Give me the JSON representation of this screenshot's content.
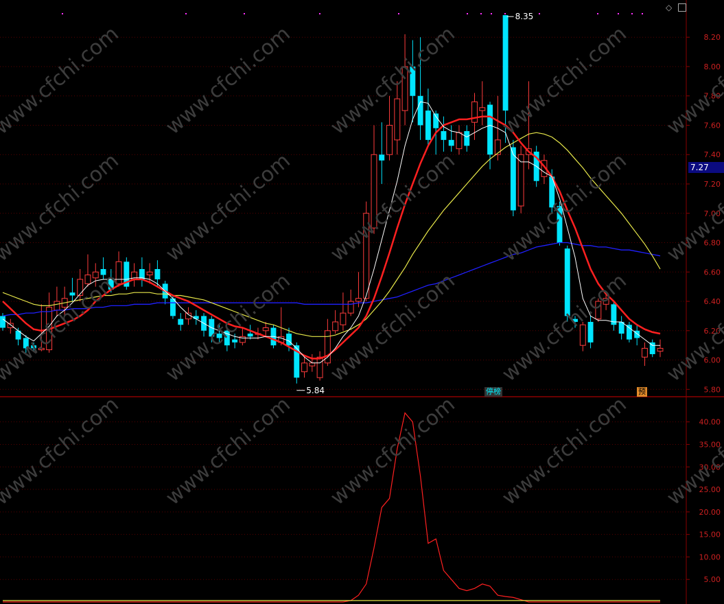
{
  "chart_data": [
    {
      "type": "candlestick",
      "title": "",
      "y_ticks": [
        "8.20",
        "8.00",
        "7.80",
        "7.60",
        "7.40",
        "7.20",
        "7.00",
        "6.80",
        "6.60",
        "6.40",
        "6.20",
        "6.00",
        "5.80"
      ],
      "ylim": [
        5.75,
        8.36
      ],
      "current_price_label": "7.27",
      "high_annotation": "8.35",
      "low_annotation": "5.84",
      "event_badges": [
        "停榜",
        "预"
      ],
      "colors": {
        "up": "#ff3c3c",
        "down": "#00e5ff",
        "ma_white": "#ffffff",
        "ma_red": "#ff2020",
        "ma_yellow": "#e8e84a",
        "ma_blue": "#2020ff",
        "grid": "#5a0000"
      },
      "candles": [
        [
          6.3,
          6.22,
          6.32,
          6.2
        ],
        [
          6.22,
          6.25,
          6.28,
          6.18
        ],
        [
          6.2,
          6.14,
          6.22,
          6.1
        ],
        [
          6.15,
          6.08,
          6.17,
          6.05
        ],
        [
          6.1,
          6.08,
          6.12,
          6.06
        ],
        [
          6.07,
          6.08,
          6.38,
          6.06
        ],
        [
          6.07,
          6.36,
          6.46,
          6.05
        ],
        [
          6.34,
          6.4,
          6.5,
          6.3
        ],
        [
          6.36,
          6.42,
          6.5,
          6.3
        ],
        [
          6.46,
          6.44,
          6.56,
          6.4
        ],
        [
          6.44,
          6.55,
          6.62,
          6.4
        ],
        [
          6.52,
          6.58,
          6.72,
          6.5
        ],
        [
          6.56,
          6.6,
          6.66,
          6.5
        ],
        [
          6.62,
          6.58,
          6.7,
          6.55
        ],
        [
          6.56,
          6.48,
          6.62,
          6.46
        ],
        [
          6.52,
          6.67,
          6.74,
          6.5
        ],
        [
          6.67,
          6.5,
          6.7,
          6.48
        ],
        [
          6.55,
          6.6,
          6.66,
          6.5
        ],
        [
          6.62,
          6.55,
          6.7,
          6.5
        ],
        [
          6.58,
          6.6,
          6.66,
          6.52
        ],
        [
          6.62,
          6.55,
          6.68,
          6.5
        ],
        [
          6.52,
          6.42,
          6.54,
          6.38
        ],
        [
          6.42,
          6.3,
          6.44,
          6.28
        ],
        [
          6.28,
          6.24,
          6.32,
          6.2
        ],
        [
          6.28,
          6.32,
          6.36,
          6.24
        ],
        [
          6.3,
          6.28,
          6.34,
          6.24
        ],
        [
          6.3,
          6.2,
          6.32,
          6.16
        ],
        [
          6.28,
          6.16,
          6.3,
          6.12
        ],
        [
          6.18,
          6.15,
          6.24,
          6.12
        ],
        [
          6.2,
          6.1,
          6.22,
          6.06
        ],
        [
          6.14,
          6.12,
          6.18,
          6.08
        ],
        [
          6.12,
          6.16,
          6.22,
          6.1
        ],
        [
          6.18,
          6.16,
          6.24,
          6.14
        ],
        [
          6.18,
          6.18,
          6.22,
          6.14
        ],
        [
          6.2,
          6.22,
          6.26,
          6.16
        ],
        [
          6.22,
          6.1,
          6.24,
          6.08
        ],
        [
          6.12,
          6.16,
          6.36,
          6.1
        ],
        [
          6.18,
          6.1,
          6.22,
          6.06
        ],
        [
          6.1,
          5.88,
          6.12,
          5.84
        ],
        [
          5.92,
          5.98,
          6.02,
          5.88
        ],
        [
          5.96,
          5.98,
          6.04,
          5.92
        ],
        [
          5.88,
          6.02,
          6.06,
          5.86
        ],
        [
          5.98,
          6.2,
          6.28,
          5.96
        ],
        [
          6.2,
          6.26,
          6.34,
          6.18
        ],
        [
          6.24,
          6.32,
          6.46,
          6.2
        ],
        [
          6.32,
          6.4,
          6.48,
          6.3
        ],
        [
          6.4,
          6.42,
          6.6,
          6.36
        ],
        [
          6.42,
          7.0,
          7.08,
          6.4
        ],
        [
          6.9,
          7.4,
          7.6,
          6.86
        ],
        [
          7.4,
          7.36,
          7.62,
          7.2
        ],
        [
          7.4,
          7.6,
          7.8,
          7.36
        ],
        [
          7.5,
          7.78,
          7.9,
          7.4
        ],
        [
          7.7,
          8.0,
          8.22,
          7.6
        ],
        [
          8.0,
          7.8,
          8.18,
          7.62
        ],
        [
          7.8,
          7.6,
          8.2,
          7.5
        ],
        [
          7.7,
          7.5,
          7.85,
          7.46
        ],
        [
          7.68,
          7.58,
          7.7,
          7.4
        ],
        [
          7.56,
          7.5,
          7.66,
          7.42
        ],
        [
          7.5,
          7.46,
          7.6,
          7.42
        ],
        [
          7.44,
          7.55,
          7.6,
          7.4
        ],
        [
          7.56,
          7.46,
          7.6,
          7.42
        ],
        [
          7.62,
          7.76,
          7.82,
          7.5
        ],
        [
          7.7,
          7.72,
          7.9,
          7.6
        ],
        [
          7.74,
          7.4,
          7.76,
          7.3
        ],
        [
          7.4,
          7.5,
          7.8,
          7.36
        ],
        [
          8.35,
          7.7,
          8.35,
          7.48
        ],
        [
          7.45,
          7.02,
          7.5,
          6.98
        ],
        [
          7.05,
          7.4,
          7.46,
          7.0
        ],
        [
          7.4,
          7.44,
          7.9,
          7.3
        ],
        [
          7.42,
          7.22,
          7.46,
          7.18
        ],
        [
          7.25,
          7.36,
          7.4,
          7.2
        ],
        [
          7.25,
          7.04,
          7.3,
          7.0
        ],
        [
          7.05,
          6.8,
          7.08,
          6.78
        ],
        [
          6.76,
          6.3,
          6.78,
          6.26
        ],
        [
          6.28,
          6.26,
          6.3,
          6.22
        ],
        [
          6.1,
          6.24,
          6.26,
          6.06
        ],
        [
          6.26,
          6.12,
          6.3,
          6.08
        ],
        [
          6.28,
          6.4,
          6.42,
          6.26
        ],
        [
          6.38,
          6.42,
          6.46,
          6.34
        ],
        [
          6.38,
          6.24,
          6.4,
          6.2
        ],
        [
          6.26,
          6.18,
          6.3,
          6.14
        ],
        [
          6.24,
          6.14,
          6.26,
          6.12
        ],
        [
          6.2,
          6.15,
          6.24,
          6.1
        ],
        [
          6.02,
          6.08,
          6.12,
          5.96
        ],
        [
          6.12,
          6.04,
          6.14,
          6.02
        ],
        [
          6.06,
          6.08,
          6.14,
          6.02
        ]
      ],
      "ma_white": [
        6.28,
        6.24,
        6.2,
        6.16,
        6.13,
        6.18,
        6.23,
        6.3,
        6.34,
        6.39,
        6.45,
        6.51,
        6.54,
        6.55,
        6.55,
        6.55,
        6.55,
        6.56,
        6.56,
        6.55,
        6.52,
        6.47,
        6.42,
        6.36,
        6.31,
        6.28,
        6.25,
        6.22,
        6.2,
        6.18,
        6.16,
        6.15,
        6.15,
        6.15,
        6.16,
        6.16,
        6.15,
        6.13,
        6.08,
        6.02,
        5.98,
        5.98,
        6.02,
        6.08,
        6.16,
        6.22,
        6.3,
        6.44,
        6.62,
        6.82,
        7.02,
        7.22,
        7.46,
        7.64,
        7.76,
        7.75,
        7.66,
        7.59,
        7.56,
        7.55,
        7.52,
        7.55,
        7.58,
        7.6,
        7.58,
        7.55,
        7.4,
        7.35,
        7.35,
        7.32,
        7.28,
        7.25,
        7.1,
        6.9,
        6.7,
        6.42,
        6.3,
        6.27,
        6.27,
        6.26,
        6.26,
        6.22,
        6.18,
        6.14,
        6.1,
        6.1
      ],
      "ma_red": [
        6.4,
        6.35,
        6.3,
        6.25,
        6.21,
        6.2,
        6.21,
        6.23,
        6.25,
        6.27,
        6.3,
        6.34,
        6.4,
        6.44,
        6.48,
        6.51,
        6.53,
        6.55,
        6.55,
        6.53,
        6.5,
        6.47,
        6.44,
        6.42,
        6.4,
        6.37,
        6.34,
        6.31,
        6.28,
        6.25,
        6.23,
        6.22,
        6.2,
        6.18,
        6.16,
        6.14,
        6.12,
        6.09,
        6.06,
        6.03,
        6.01,
        6.01,
        6.03,
        6.07,
        6.12,
        6.17,
        6.22,
        6.3,
        6.42,
        6.57,
        6.73,
        6.9,
        7.06,
        7.2,
        7.34,
        7.46,
        7.55,
        7.6,
        7.62,
        7.64,
        7.64,
        7.65,
        7.66,
        7.66,
        7.63,
        7.6,
        7.55,
        7.48,
        7.42,
        7.38,
        7.32,
        7.25,
        7.15,
        7.02,
        6.9,
        6.76,
        6.62,
        6.52,
        6.45,
        6.4,
        6.34,
        6.28,
        6.24,
        6.21,
        6.19,
        6.18
      ],
      "ma_yellow": [
        6.46,
        6.44,
        6.42,
        6.4,
        6.38,
        6.37,
        6.37,
        6.38,
        6.39,
        6.4,
        6.41,
        6.42,
        6.43,
        6.44,
        6.44,
        6.45,
        6.45,
        6.46,
        6.46,
        6.46,
        6.45,
        6.45,
        6.44,
        6.44,
        6.43,
        6.42,
        6.41,
        6.39,
        6.37,
        6.35,
        6.33,
        6.31,
        6.29,
        6.27,
        6.25,
        6.24,
        6.22,
        6.2,
        6.18,
        6.17,
        6.16,
        6.16,
        6.16,
        6.17,
        6.19,
        6.21,
        6.24,
        6.28,
        6.34,
        6.4,
        6.47,
        6.55,
        6.63,
        6.72,
        6.8,
        6.88,
        6.95,
        7.02,
        7.08,
        7.14,
        7.2,
        7.26,
        7.32,
        7.37,
        7.41,
        7.45,
        7.48,
        7.51,
        7.54,
        7.55,
        7.54,
        7.52,
        7.48,
        7.43,
        7.37,
        7.31,
        7.24,
        7.18,
        7.12,
        7.06,
        7.0,
        6.93,
        6.86,
        6.79,
        6.71,
        6.62
      ],
      "ma_blue": [
        6.3,
        6.31,
        6.31,
        6.32,
        6.32,
        6.33,
        6.33,
        6.34,
        6.34,
        6.35,
        6.35,
        6.35,
        6.36,
        6.36,
        6.37,
        6.37,
        6.37,
        6.38,
        6.38,
        6.38,
        6.39,
        6.39,
        6.39,
        6.39,
        6.39,
        6.39,
        6.39,
        6.39,
        6.39,
        6.39,
        6.39,
        6.39,
        6.39,
        6.39,
        6.39,
        6.39,
        6.39,
        6.39,
        6.39,
        6.38,
        6.38,
        6.38,
        6.38,
        6.38,
        6.38,
        6.38,
        6.39,
        6.39,
        6.4,
        6.41,
        6.42,
        6.43,
        6.45,
        6.47,
        6.49,
        6.51,
        6.52,
        6.54,
        6.56,
        6.58,
        6.6,
        6.62,
        6.64,
        6.66,
        6.68,
        6.7,
        6.72,
        6.73,
        6.75,
        6.77,
        6.78,
        6.79,
        6.8,
        6.8,
        6.79,
        6.78,
        6.78,
        6.77,
        6.77,
        6.76,
        6.75,
        6.75,
        6.74,
        6.73,
        6.72,
        6.71
      ]
    },
    {
      "type": "line",
      "title": "",
      "y_ticks": [
        "40.00",
        "35.00",
        "30.00",
        "25.00",
        "20.00",
        "15.00",
        "10.00",
        "5.00"
      ],
      "ylim": [
        0,
        43
      ],
      "series": [
        {
          "color": "#ff2020",
          "values": [
            0,
            0,
            0,
            0,
            0,
            0,
            0,
            0,
            0,
            0,
            0,
            0,
            0,
            0,
            0,
            0,
            0,
            0,
            0,
            0,
            0,
            0,
            0,
            0,
            0,
            0,
            0,
            0,
            0,
            0,
            0,
            0,
            0,
            0,
            0,
            0,
            0,
            0,
            0,
            0,
            0,
            0,
            0,
            0,
            0,
            0.3,
            1.5,
            4,
            12,
            21,
            23,
            34,
            42,
            40,
            28,
            13,
            14,
            7,
            5,
            3,
            2.5,
            3,
            4,
            3.5,
            1.5,
            1.2,
            1,
            0.5,
            0,
            0,
            0,
            0,
            0,
            0,
            0,
            0,
            0,
            0,
            0,
            0,
            0,
            0,
            0,
            0,
            0,
            0
          ]
        },
        {
          "color": "#e8e84a",
          "values": [
            0.3,
            0.3,
            0.3,
            0.3,
            0.3,
            0.3,
            0.3,
            0.3,
            0.3,
            0.3,
            0.3,
            0.3,
            0.3,
            0.3,
            0.3,
            0.3,
            0.3,
            0.3,
            0.3,
            0.3,
            0.3,
            0.3,
            0.3,
            0.3,
            0.3,
            0.3,
            0.3,
            0.3,
            0.3,
            0.3,
            0.3,
            0.3,
            0.3,
            0.3,
            0.3,
            0.3,
            0.3,
            0.3,
            0.3,
            0.3,
            0.3,
            0.3,
            0.3,
            0.3,
            0.3,
            0.3,
            0.3,
            0.3,
            0.3,
            0.3,
            0.3,
            0.3,
            0.3,
            0.3,
            0.3,
            0.3,
            0.3,
            0.3,
            0.3,
            0.3,
            0.3,
            0.3,
            0.3,
            0.3,
            0.3,
            0.3,
            0.3,
            0.3,
            0.3,
            0.3,
            0.3,
            0.3,
            0.3,
            0.3,
            0.3,
            0.3,
            0.3,
            0.3,
            0.3,
            0.3,
            0.3,
            0.3,
            0.3,
            0.3,
            0.3,
            0.3
          ]
        }
      ]
    }
  ],
  "watermark": "www.cfchi.com",
  "corner_icons": [
    "diamond-icon",
    "window-icon"
  ]
}
